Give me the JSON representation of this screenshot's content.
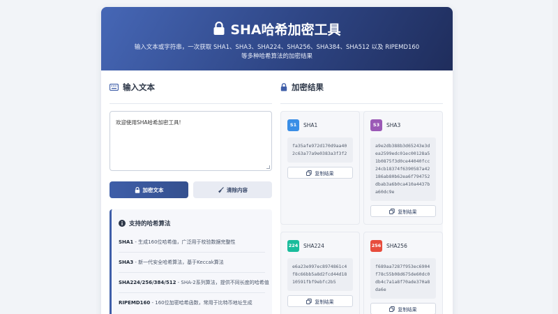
{
  "header": {
    "title": "SHA哈希加密工具",
    "subtitle_line1": "输入文本或字符串，一次获取 SHA1、SHA3、SHA224、SHA256、SHA384、SHA512 以及 RIPEMD160",
    "subtitle_line2": "等多种哈希算法的加密结果"
  },
  "input": {
    "section_title": "输入文本",
    "value": "欢迎使用SHA哈希加密工具!",
    "encrypt_label": "加密文本",
    "clear_label": "清除内容"
  },
  "info": {
    "title": "支持的哈希算法",
    "items": [
      {
        "name": "SHA1",
        "desc": " - 生成160位哈希值，广泛用于校验数据完整性"
      },
      {
        "name": "SHA3",
        "desc": " - 新一代安全哈希算法，基于Keccak算法"
      },
      {
        "name": "SHA224/256/384/512",
        "desc": " - SHA-2系列算法，提供不同长度的哈希值"
      },
      {
        "name": "RIPEMD160",
        "desc": " - 160位加密哈希函数，常用于比特币地址生成"
      }
    ]
  },
  "results": {
    "section_title": "加密结果",
    "copy_label": "复制结果",
    "cards": [
      {
        "badge": "S1",
        "name": "SHA1",
        "color": "#3a8ee6",
        "hash": "fa35afe972d170d9aa402c63a77a9e0383a3f3f2"
      },
      {
        "badge": "S3",
        "name": "SHA3",
        "color": "#9b59b6",
        "hash": "a9e2db388b3d65243e3dea2599edc01ec00128a51b0875f3d0ce44040fcc24cb18374f6390587a42186ab80b62ea6f794752dbab3a6b0ca410a4437ba60dc9e"
      },
      {
        "badge": "224",
        "name": "SHA224",
        "color": "#1abc9c",
        "hash": "e6a23e997ec8974861c4f8c66bb5a8d2fcd44d1810591fbf9ebfc2b5"
      },
      {
        "badge": "256",
        "name": "SHA256",
        "color": "#e74c3c",
        "hash": "f689aa7287f953ec6904f78c55b08d675de60dc0db4c7a1a8f70ade370a8da6e"
      }
    ]
  }
}
